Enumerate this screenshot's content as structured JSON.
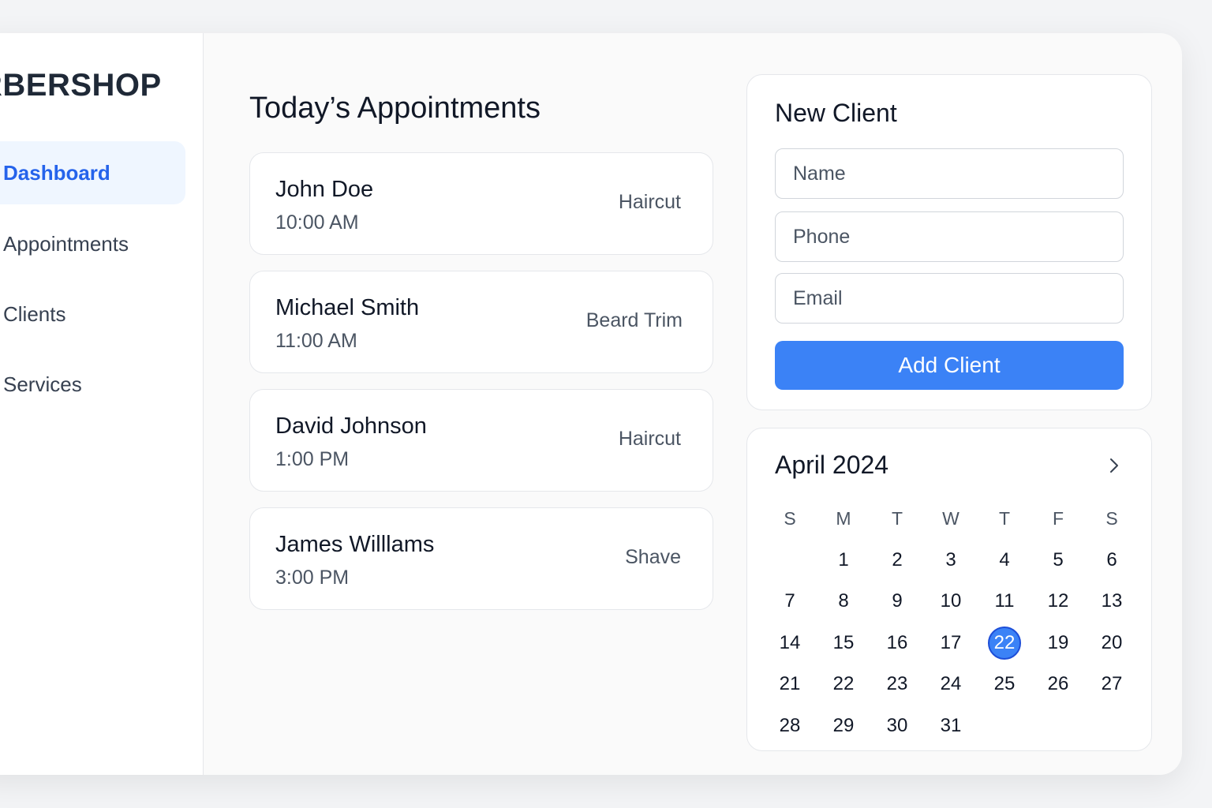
{
  "sidebar": {
    "brand": "RBERSHOP",
    "items": [
      {
        "label": "Dashboard"
      },
      {
        "label": "Appointments"
      },
      {
        "label": "Clients"
      },
      {
        "label": "Services"
      }
    ]
  },
  "main": {
    "title": "Today’s Appointments",
    "appointments": [
      {
        "name": "John Doe",
        "time": "10:00 AM",
        "service": "Haircut"
      },
      {
        "name": "Michael Smith",
        "time": "11:00 AM",
        "service": "Beard Trim"
      },
      {
        "name": "David Johnson",
        "time": "1:00 PM",
        "service": "Haircut"
      },
      {
        "name": "James Willlams",
        "time": "3:00 PM",
        "service": "Shave"
      }
    ]
  },
  "new_client": {
    "title": "New Client",
    "name_placeholder": "Name",
    "phone_placeholder": "Phone",
    "email_placeholder": "Email",
    "button_label": "Add Client"
  },
  "calendar": {
    "month_label": "April 2024",
    "next_icon": "chevron-right-icon",
    "weekdays": [
      "S",
      "M",
      "T",
      "W",
      "T",
      "F",
      "S"
    ],
    "weeks": [
      [
        "",
        "1",
        "2",
        "3",
        "4",
        "5",
        "6"
      ],
      [
        "7",
        "8",
        "9",
        "10",
        "11",
        "12",
        "13"
      ],
      [
        "14",
        "15",
        "16",
        "17",
        "22",
        "19",
        "20"
      ],
      [
        "21",
        "22",
        "23",
        "24",
        "25",
        "26",
        "27"
      ],
      [
        "28",
        "29",
        "30",
        "31",
        "",
        "",
        ""
      ]
    ],
    "selected": "22"
  },
  "colors": {
    "accent": "#3b82f6",
    "active_nav_bg": "#eff6ff",
    "active_nav_text": "#2563eb"
  }
}
